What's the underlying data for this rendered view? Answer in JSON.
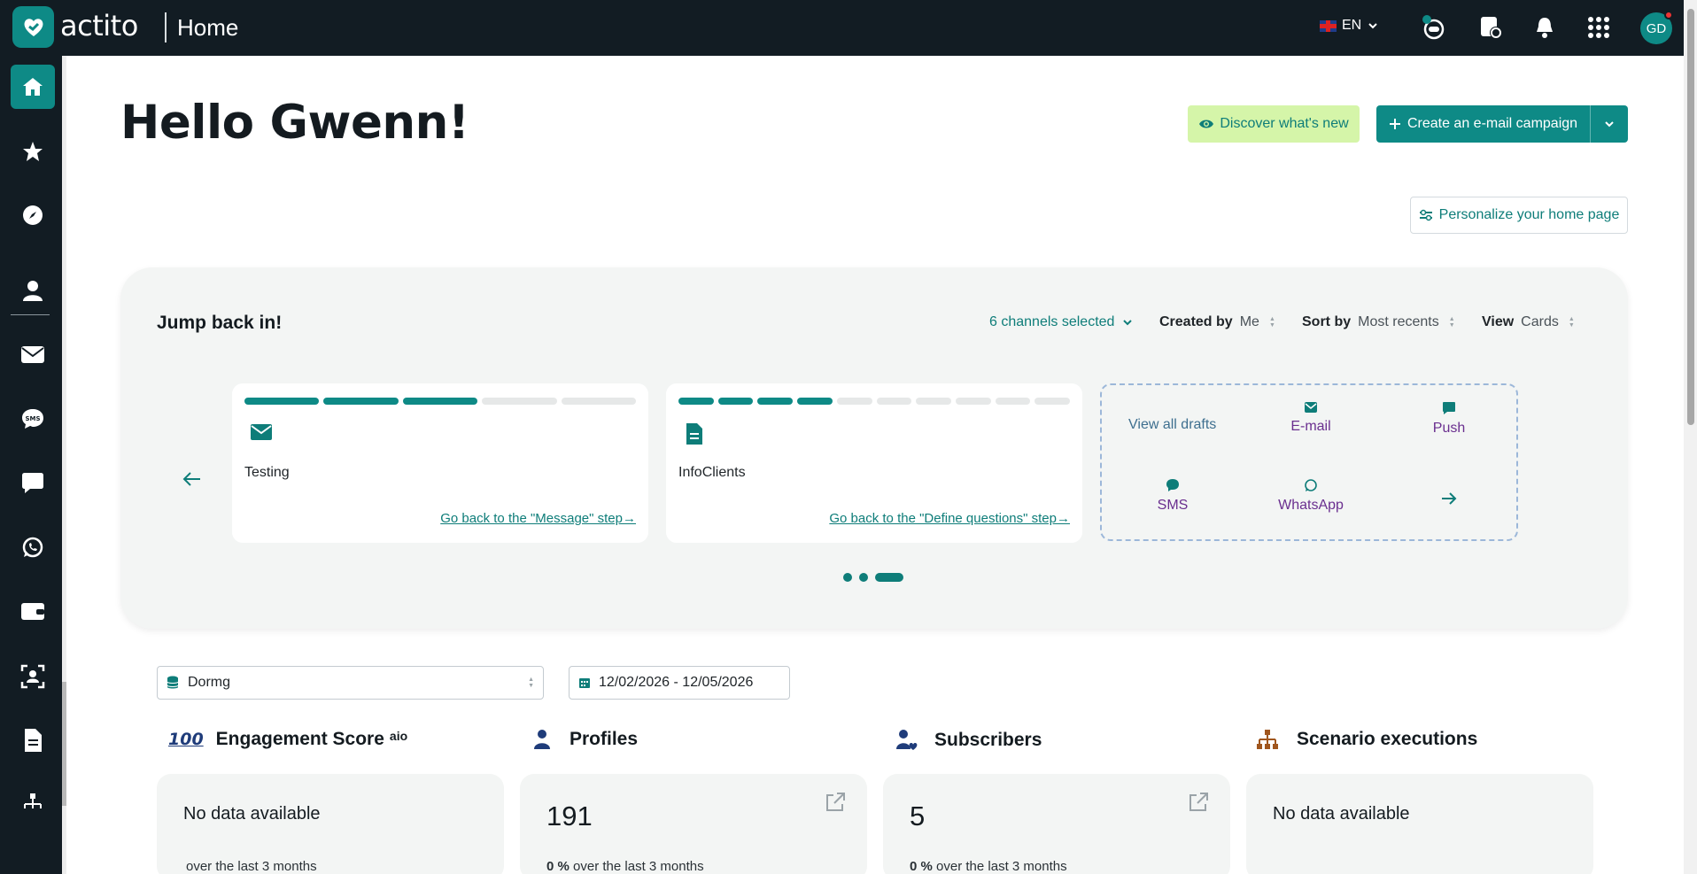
{
  "topbar": {
    "brand": "actito",
    "page_title": "Home",
    "language": "EN",
    "avatar_initials": "GD"
  },
  "main": {
    "greeting": "Hello Gwenn!",
    "discover_label": "Discover what's new",
    "create_label": "Create an e-mail campaign",
    "personalize_label": "Personalize your home page"
  },
  "jump_back": {
    "title": "Jump back in!",
    "channels_label": "6 channels selected",
    "created_by_key": "Created by",
    "created_by_value": "Me",
    "sort_by_key": "Sort by",
    "sort_by_value": "Most recents",
    "view_key": "View",
    "view_value": "Cards",
    "cards": [
      {
        "name": "Testing",
        "link": "Go back to the \"Message\" step",
        "progress_steps": 5,
        "progress_done": 3,
        "icon": "envelope-icon"
      },
      {
        "name": "InfoClients",
        "link": "Go back to the \"Define questions\" step",
        "progress_steps": 10,
        "progress_done": 4,
        "icon": "document-icon"
      }
    ],
    "drafts": {
      "view_all": "View all drafts",
      "email": "E-mail",
      "push": "Push",
      "sms": "SMS",
      "whatsapp": "WhatsApp"
    },
    "carousel_pages": 3,
    "carousel_active": 3
  },
  "filters": {
    "database": "Dormg",
    "date_range": "12/02/2026 - 12/05/2026"
  },
  "kpis": [
    {
      "title": "Engagement Score",
      "badge": "aio",
      "value": "No data available",
      "sub_value": "",
      "sub": "over the last 3 months"
    },
    {
      "title": "Profiles",
      "value": "191",
      "sub_value": "0 %",
      "sub": "over the last 3 months"
    },
    {
      "title": "Subscribers",
      "value": "5",
      "sub_value": "0 %",
      "sub": "over the last 3 months"
    },
    {
      "title": "Scenario executions",
      "value": "No data available",
      "sub_value": "",
      "sub": ""
    }
  ],
  "colors": {
    "primary": "#0e8a86",
    "dark": "#121c23",
    "highlight": "#d5f5a9",
    "draft_text": "#6a2f8f"
  }
}
